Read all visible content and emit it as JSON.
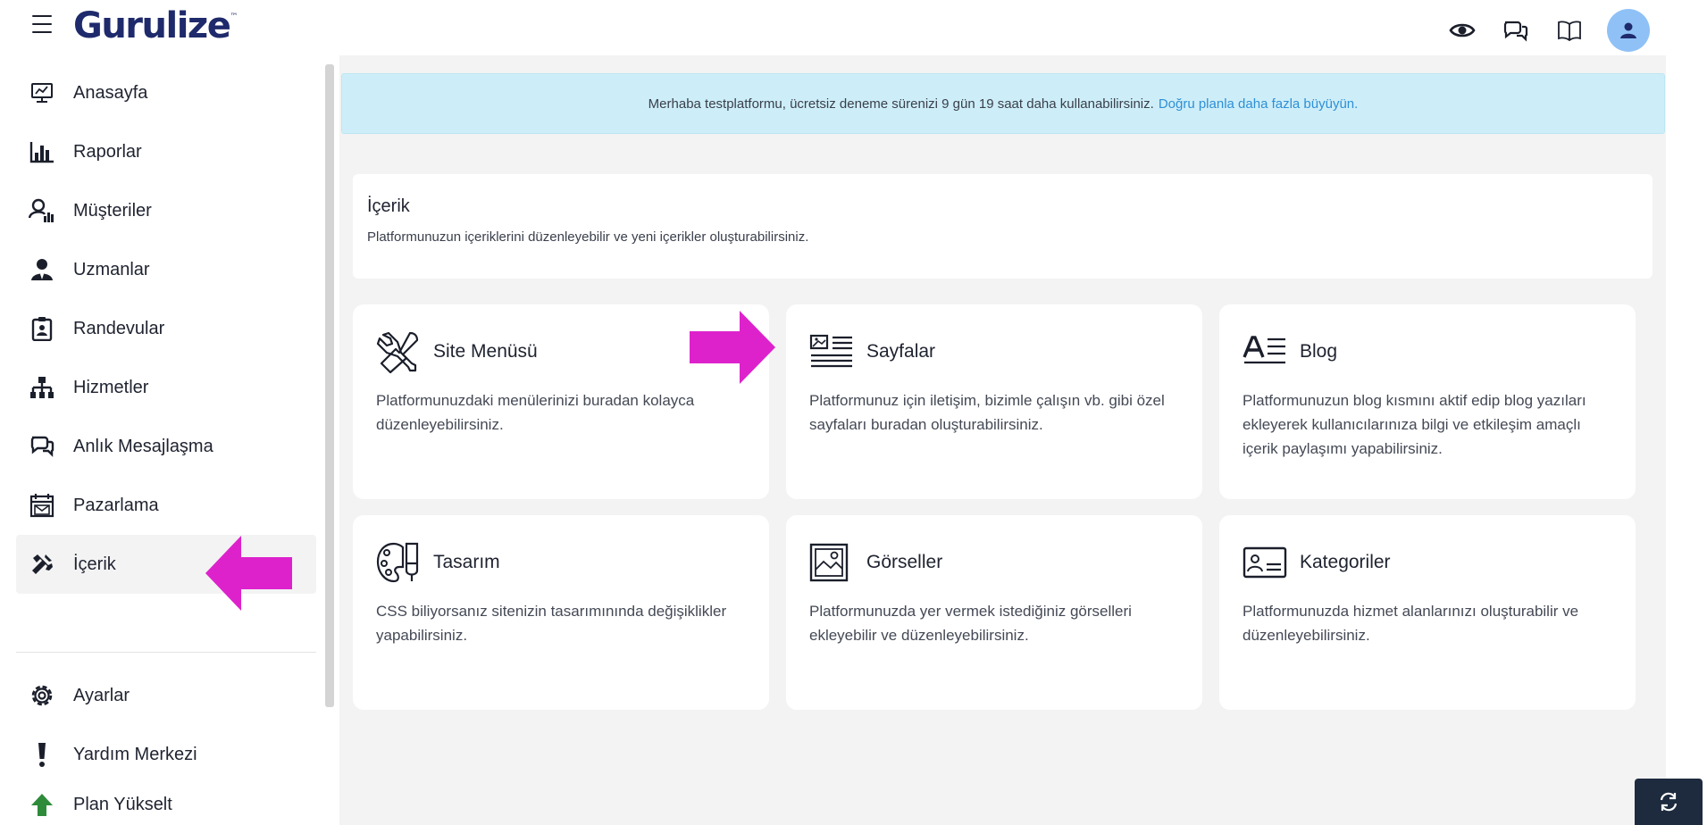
{
  "app": {
    "logo_text": "Gurulize",
    "logo_mark": "™"
  },
  "header": {
    "icons": [
      "eye-icon",
      "chat-icon",
      "book-icon",
      "user-avatar-icon"
    ]
  },
  "sidebar": {
    "items": [
      {
        "label": "Anasayfa",
        "icon": "monitor-icon"
      },
      {
        "label": "Raporlar",
        "icon": "bar-chart-icon"
      },
      {
        "label": "Müşteriler",
        "icon": "customers-chart-icon"
      },
      {
        "label": "Uzmanlar",
        "icon": "user-tie-icon"
      },
      {
        "label": "Randevular",
        "icon": "clipboard-user-icon"
      },
      {
        "label": "Hizmetler",
        "icon": "sitemap-icon"
      },
      {
        "label": "Anlık Mesajlaşma",
        "icon": "chat-icon"
      },
      {
        "label": "Pazarlama",
        "icon": "calendar-mail-icon"
      },
      {
        "label": "İçerik",
        "icon": "tools-icon",
        "active": true
      }
    ],
    "bottom_items": [
      {
        "label": "Ayarlar",
        "icon": "gear-icon"
      },
      {
        "label": "Yardım Merkezi",
        "icon": "exclamation-icon"
      },
      {
        "label": "Plan Yükselt",
        "icon": "upgrade-arrow-icon"
      }
    ]
  },
  "banner": {
    "text": "Merhaba testplatformu, ücretsiz deneme sürenizi 9 gün 19 saat daha kullanabilirsiniz.",
    "link": "Doğru planla daha fazla büyüyün."
  },
  "content_header": {
    "title": "İçerik",
    "description": "Platformunuzun içeriklerini düzenleyebilir ve yeni içerikler oluşturabilirsiniz."
  },
  "cards": [
    {
      "title": "Site Menüsü",
      "icon": "tools-icon",
      "description": "Platformunuzdaki menülerinizi buradan kolayca düzenleyebilirsiniz."
    },
    {
      "title": "Sayfalar",
      "icon": "pages-icon",
      "description": "Platformunuz için iletişim, bizimle çalışın vb. gibi özel sayfaları buradan oluşturabilirsiniz."
    },
    {
      "title": "Blog",
      "icon": "blog-text-icon",
      "description": "Platformunuzun blog kısmını aktif edip blog yazıları ekleyerek kullanıcılarınıza bilgi ve etkileşim amaçlı içerik paylaşımı yapabilirsiniz."
    },
    {
      "title": "Tasarım",
      "icon": "palette-icon",
      "description": "CSS biliyorsanız sitenizin tasarımınında değişiklikler yapabilirsiniz."
    },
    {
      "title": "Görseller",
      "icon": "image-icon",
      "description": "Platformunuzda yer vermek istediğiniz görselleri ekleyebilir ve düzenleyebilirsiniz."
    },
    {
      "title": "Kategoriler",
      "icon": "category-card-icon",
      "description": "Platformunuzda hizmet alanlarınızı oluşturabilir ve düzenleyebilirsiniz."
    }
  ],
  "colors": {
    "annotation_arrow": "#dd22cc",
    "banner_bg": "#cdeef8",
    "link": "#2f8fd6",
    "logo": "#1e2a6b",
    "avatar_bg": "#8fc1f6",
    "refresh_button_bg": "#1e2a3e"
  }
}
